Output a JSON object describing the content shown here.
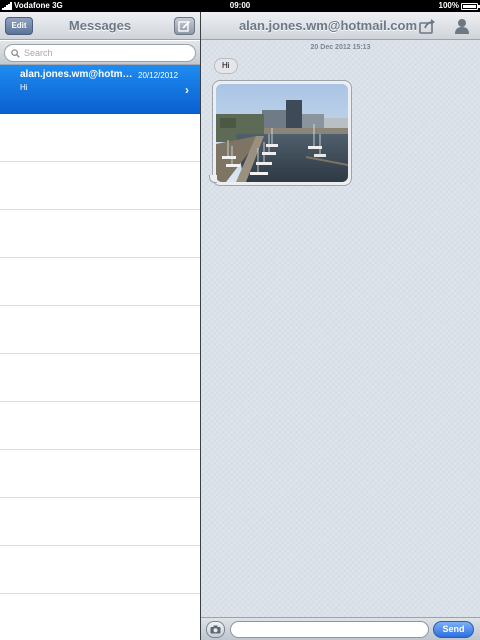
{
  "status_bar": {
    "carrier": "Vodafone 3G",
    "time": "09:00",
    "battery_text": "100%",
    "battery_level": 1.0
  },
  "sidebar": {
    "edit_label": "Edit",
    "title": "Messages",
    "compose_icon": "compose-icon",
    "search_placeholder": "Search",
    "search_icon": "search-icon",
    "conversations": [
      {
        "sender": "alan.jones.wm@hotmail.com",
        "date": "20/12/2012",
        "preview": "Hi"
      }
    ]
  },
  "conversation": {
    "title": "alan.jones.wm@hotmail.com",
    "share_icon": "share-icon",
    "contact_icon": "contact-icon",
    "timestamp": "20 Dec 2012 15:13",
    "messages": [
      {
        "type": "text",
        "text": "Hi"
      },
      {
        "type": "image",
        "description": "harbour-photo"
      }
    ],
    "input_placeholder": "",
    "send_label": "Send",
    "camera_icon": "camera-icon"
  },
  "colors": {
    "selection_blue": "#0a5fd0",
    "send_blue": "#2d6fe0",
    "pane_background": "#dbe1e9"
  }
}
